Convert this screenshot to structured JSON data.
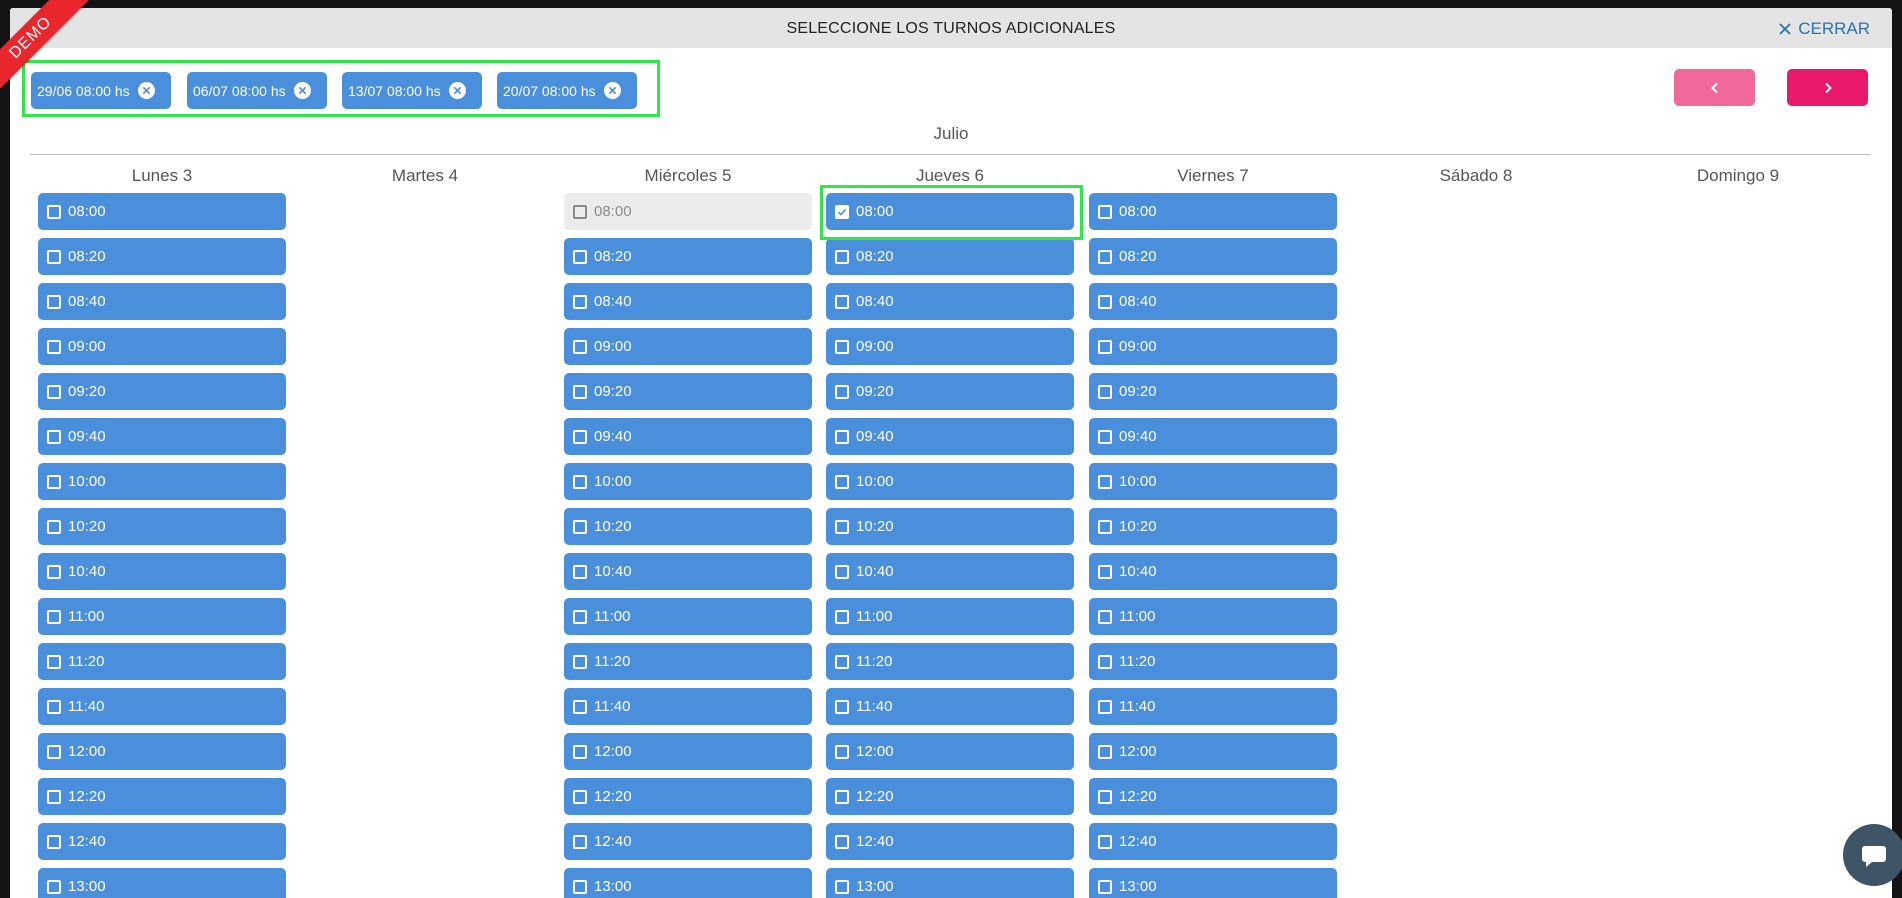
{
  "ribbon": "DEMO",
  "modal": {
    "title": "SELECCIONE LOS TURNOS ADICIONALES",
    "close_label": "CERRAR"
  },
  "selected_chips": [
    {
      "label": "29/06 08:00 hs"
    },
    {
      "label": "06/07 08:00 hs"
    },
    {
      "label": "13/07 08:00 hs"
    },
    {
      "label": "20/07 08:00 hs"
    }
  ],
  "nav": {
    "prev_icon": "chevron-left-icon",
    "next_icon": "chevron-right-icon"
  },
  "month": "Julio",
  "days": [
    {
      "label": "Lunes 3",
      "slots": [
        "08:00",
        "08:20",
        "08:40",
        "09:00",
        "09:20",
        "09:40",
        "10:00",
        "10:20",
        "10:40",
        "11:00",
        "11:20",
        "11:40",
        "12:00",
        "12:20",
        "12:40",
        "13:00"
      ]
    },
    {
      "label": "Martes 4",
      "slots": []
    },
    {
      "label": "Miércoles 5",
      "slots": [
        "08:00",
        "08:20",
        "08:40",
        "09:00",
        "09:20",
        "09:40",
        "10:00",
        "10:20",
        "10:40",
        "11:00",
        "11:20",
        "11:40",
        "12:00",
        "12:20",
        "12:40",
        "13:00"
      ],
      "disabled": [
        "08:00"
      ]
    },
    {
      "label": "Jueves 6",
      "slots": [
        "08:00",
        "08:20",
        "08:40",
        "09:00",
        "09:20",
        "09:40",
        "10:00",
        "10:20",
        "10:40",
        "11:00",
        "11:20",
        "11:40",
        "12:00",
        "12:20",
        "12:40",
        "13:00"
      ],
      "checked": [
        "08:00"
      ]
    },
    {
      "label": "Viernes 7",
      "slots": [
        "08:00",
        "08:20",
        "08:40",
        "09:00",
        "09:20",
        "09:40",
        "10:00",
        "10:20",
        "10:40",
        "11:00",
        "11:20",
        "11:40",
        "12:00",
        "12:20",
        "12:40",
        "13:00"
      ]
    },
    {
      "label": "Sábado 8",
      "slots": []
    },
    {
      "label": "Domingo 9",
      "slots": []
    }
  ],
  "colors": {
    "slot": "#4a8fdc",
    "slot_disabled": "#ececec",
    "highlight": "#2ee84a",
    "prev_button": "#f0699a",
    "next_button": "#e8196b",
    "ribbon": "#e8262c"
  }
}
